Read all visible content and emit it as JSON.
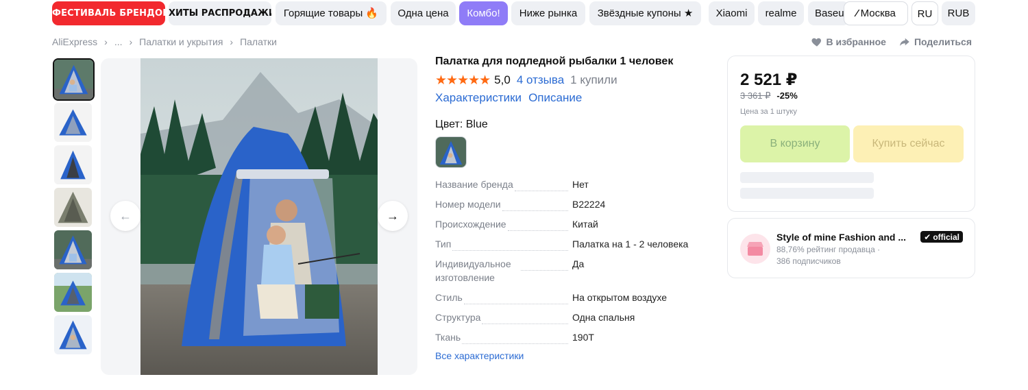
{
  "topbar": {
    "chips": [
      {
        "label": "ФЕСТИВАЛЬ БРЕНДОВ",
        "style": "festival"
      },
      {
        "label": "ХИТЫ РАСПРОДАЖИ",
        "style": "hits"
      },
      {
        "label": "Горящие товары 🔥",
        "style": "normal"
      },
      {
        "label": "Одна цена",
        "style": "normal"
      },
      {
        "label": "Комбо!",
        "style": "combo"
      },
      {
        "label": "Ниже рынка",
        "style": "normal"
      },
      {
        "label": "Звёздные купоны ★",
        "style": "normal"
      },
      {
        "label": "Xiaomi",
        "style": "normal"
      },
      {
        "label": "realme",
        "style": "normal"
      },
      {
        "label": "Baseus",
        "style": "normal"
      }
    ],
    "location": "Москва",
    "language": "RU",
    "currency": "RUB"
  },
  "breadcrumb": [
    "AliExpress",
    "...",
    "Палатки и укрытия",
    "Палатки"
  ],
  "actions": {
    "favorite": "В избранное",
    "share": "Поделиться"
  },
  "product": {
    "title": "Палатка для подледной рыбалки 1 человек",
    "stars": "★★★★★",
    "rating": "5,0",
    "reviews": "4 отзыва",
    "bought": "1 купили",
    "tab_specs": "Характеристики",
    "tab_description": "Описание",
    "color_label": "Цвет: Blue",
    "specs": [
      {
        "key": "Название бренда",
        "value": "Нет"
      },
      {
        "key": "Номер модели",
        "value": "B22224"
      },
      {
        "key": "Происхождение",
        "value": "Китай"
      },
      {
        "key": "Тип",
        "value": "Палатка на 1 - 2 человека"
      },
      {
        "key": "Индивидуальное изготовление",
        "value": "Да"
      },
      {
        "key": "Стиль",
        "value": "На открытом воздухе"
      },
      {
        "key": "Структура",
        "value": "Одна спальня"
      },
      {
        "key": "Ткань",
        "value": "190T"
      }
    ],
    "all_specs": "Все характеристики"
  },
  "price_card": {
    "price": "2 521 ₽",
    "old_price": "3 361 ₽",
    "discount": "-25%",
    "per_unit": "Цена за 1 штуку",
    "cart_button": "В корзину",
    "buy_button": "Купить сейчас"
  },
  "seller": {
    "name": "Style of mine Fashion and ...",
    "rating": "88,76% рейтинг продавца ·",
    "subscribers": "386 подписчиков",
    "badge": "official"
  },
  "colors": {
    "festival": "#f2292e",
    "combo": "#8f7cf7",
    "link": "#2b6bd3",
    "stars": "#ff6a13",
    "cart_button": "#dcf3a8",
    "buy_button": "#fdf0b5",
    "tent_blue": "#2a63c9"
  }
}
